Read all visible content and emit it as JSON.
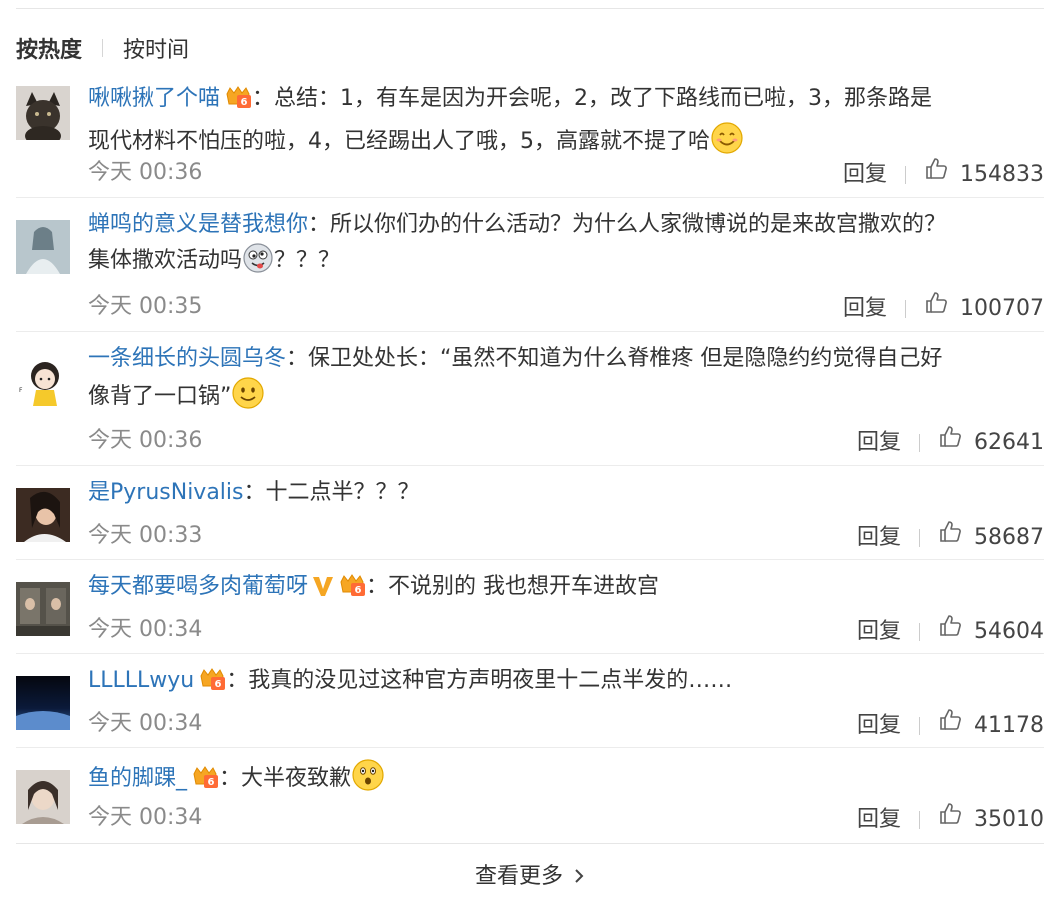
{
  "sort": {
    "hot_label": "按热度",
    "time_label": "按时间"
  },
  "comments": [
    {
      "username": "啾啾揪了个喵",
      "text_lines": [
        "：总结：1，有车是因为开会呢，2，改了下路线而已啦，3，那条路是",
        "现代材料不怕压的啦，4，已经踢出人了哦，5，高露就不提了哈"
      ],
      "time": "今天 00:36",
      "reply_label": "回复",
      "likes": "154833",
      "badges": [
        "vip-crown-icon"
      ],
      "emoji": "smile-emoji-icon"
    },
    {
      "username": "蝉鸣的意义是替我想你",
      "text_lines": [
        "：所以你们办的什么活动？为什么人家微博说的是来故宫撒欢的？",
        "集体撒欢活动吗",
        "？？？"
      ],
      "time": "今天 00:35",
      "reply_label": "回复",
      "likes": "100707",
      "badges": [],
      "emoji": "crazy-face-emoji-icon"
    },
    {
      "username": "一条细长的头圆乌冬",
      "text_lines": [
        "：保卫处处长：“虽然不知道为什么脊椎疼 但是隐隐约约觉得自己好",
        "像背了一口锅”"
      ],
      "time": "今天 00:36",
      "reply_label": "回复",
      "likes": "62641",
      "badges": [],
      "emoji": "grin-emoji-icon"
    },
    {
      "username": "是PyrusNivalis",
      "text_lines": [
        "：十二点半？？？"
      ],
      "time": "今天 00:33",
      "reply_label": "回复",
      "likes": "58687",
      "badges": [],
      "emoji": ""
    },
    {
      "username": "每天都要喝多肉葡萄呀",
      "text_lines": [
        "：不说别的 我也想开车进故宫"
      ],
      "time": "今天 00:34",
      "reply_label": "回复",
      "likes": "54604",
      "badges": [
        "verified-v-icon",
        "vip-crown-icon"
      ],
      "emoji": ""
    },
    {
      "username": "LLLLLwyu",
      "text_lines": [
        "：我真的没见过这种官方声明夜里十二点半发的……"
      ],
      "time": "今天 00:34",
      "reply_label": "回复",
      "likes": "41178",
      "badges": [
        "vip-crown-icon"
      ],
      "emoji": ""
    },
    {
      "username": "鱼的脚踝_",
      "text_lines": [
        "：大半夜致歉"
      ],
      "time": "今天 00:34",
      "reply_label": "回复",
      "likes": "35010",
      "badges": [
        "vip-crown-icon"
      ],
      "emoji": "surprised-emoji-icon"
    }
  ],
  "more_label": "查看更多",
  "colors": {
    "username": "#2d74b8",
    "text": "#333333",
    "meta": "#8a8a8a",
    "divider": "#ececec"
  }
}
